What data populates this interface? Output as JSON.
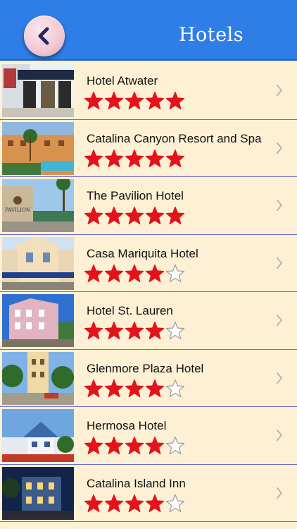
{
  "header": {
    "title": "Hotels",
    "back_icon": "chevron-left-icon"
  },
  "colors": {
    "header": "#2f7ee8",
    "row_bg": "#fdf0d5",
    "star_filled": "#e3131b",
    "divider": "#6d6fd0"
  },
  "hotels": [
    {
      "name": "Hotel Atwater",
      "rating": 5,
      "thumb": "hotel-atwater-photo"
    },
    {
      "name": "Catalina Canyon Resort and Spa",
      "rating": 5,
      "thumb": "catalina-canyon-photo"
    },
    {
      "name": "The Pavilion Hotel",
      "rating": 5,
      "thumb": "pavilion-hotel-photo"
    },
    {
      "name": "Casa Mariquita Hotel",
      "rating": 4,
      "thumb": "casa-mariquita-photo"
    },
    {
      "name": "Hotel St. Lauren",
      "rating": 4,
      "thumb": "st-lauren-photo"
    },
    {
      "name": "Glenmore Plaza Hotel",
      "rating": 4,
      "thumb": "glenmore-plaza-photo"
    },
    {
      "name": "Hermosa Hotel",
      "rating": 4,
      "thumb": "hermosa-hotel-photo"
    },
    {
      "name": "Catalina Island Inn",
      "rating": 4,
      "thumb": "catalina-island-inn-photo"
    }
  ]
}
